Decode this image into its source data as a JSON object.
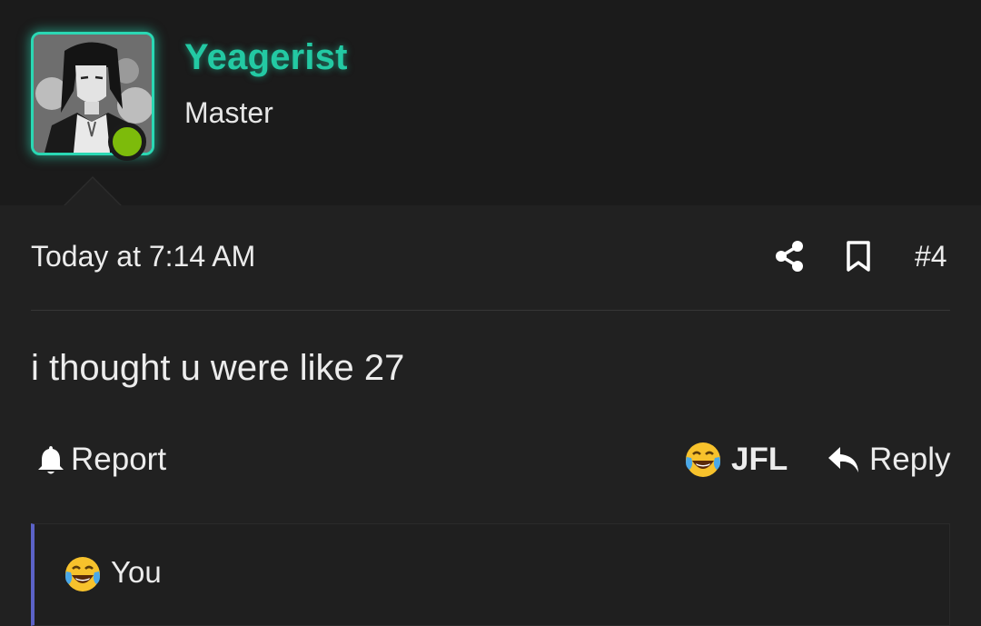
{
  "user": {
    "name": "Yeagerist",
    "title": "Master",
    "status": "online",
    "avatar_icon": "user-avatar-image",
    "name_color": "#23c9a3",
    "online_color": "#7dbb0b"
  },
  "post": {
    "timestamp": "Today at 7:14 AM",
    "number": "#4",
    "body": "i thought u were like 27",
    "share_icon": "share-icon",
    "bookmark_icon": "bookmark-icon"
  },
  "actions": {
    "report_label": "Report",
    "report_icon": "bell-icon",
    "reaction_label": "JFL",
    "reaction_icon": "laughing-crying-emoji-icon",
    "reply_label": "Reply",
    "reply_icon": "reply-arrow-icon"
  },
  "reactions": {
    "reacted_by": "You",
    "emoji_icon": "laughing-crying-emoji-icon",
    "accent_color": "#5b62c7"
  }
}
